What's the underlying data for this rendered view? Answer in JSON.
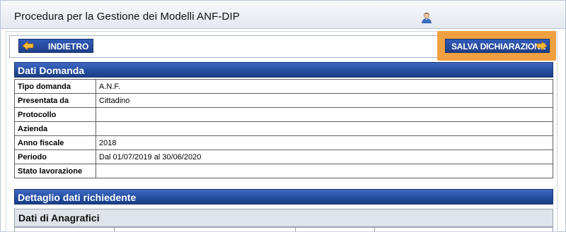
{
  "app": {
    "title": "Procedura per la Gestione dei Modelli ANF-DIP"
  },
  "toolbar": {
    "back_label": "INDIETRO",
    "save_label": "SALVA DICHIARAZIONE"
  },
  "sections": {
    "domanda_title": "Dati Domanda",
    "dettaglio_title": "Dettaglio dati richiedente",
    "anagrafici_title": "Dati di Anagrafici"
  },
  "dati_domanda": [
    {
      "label": "Tipo domanda",
      "value": "A.N.F."
    },
    {
      "label": "Presentata da",
      "value": "Cittadino"
    },
    {
      "label": "Protocollo",
      "value": ""
    },
    {
      "label": "Azienda",
      "value": ""
    },
    {
      "label": "Anno fiscale",
      "value": "2018"
    },
    {
      "label": "Periodo",
      "value": "Dal 01/07/2019 al 30/06/2020"
    },
    {
      "label": "Stato lavorazione",
      "value": ""
    }
  ],
  "colors": {
    "header_blue": "#234d9e",
    "highlight_orange": "#f0a040",
    "arrow_yellow": "#f5b73a"
  },
  "icons": {
    "user": "user-icon",
    "back": "arrow-left-icon",
    "save": "arrow-right-icon"
  }
}
